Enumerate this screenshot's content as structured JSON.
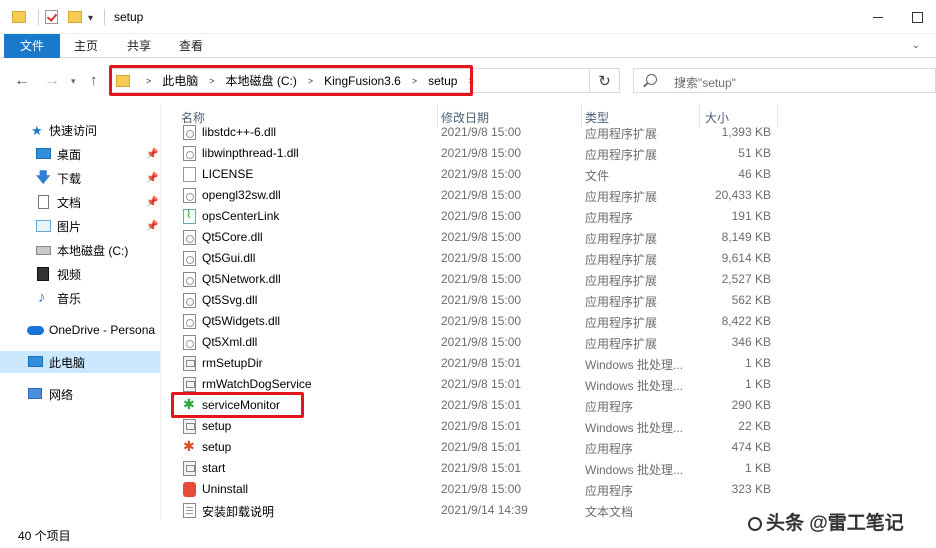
{
  "window": {
    "title": "setup"
  },
  "ribbon": {
    "tabs": [
      "文件",
      "主页",
      "共享",
      "查看"
    ]
  },
  "address": {
    "crumbs": [
      "此电脑",
      "本地磁盘 (C:)",
      "KingFusion3.6",
      "setup"
    ]
  },
  "search": {
    "placeholder": "搜索\"setup\""
  },
  "sidebar": {
    "items": [
      {
        "label": "快速访问",
        "icon": "star-icon",
        "pinned": false
      },
      {
        "label": "桌面",
        "icon": "desktop-icon",
        "pinned": true
      },
      {
        "label": "下载",
        "icon": "download-icon",
        "pinned": true
      },
      {
        "label": "文档",
        "icon": "document-icon",
        "pinned": true
      },
      {
        "label": "图片",
        "icon": "pictures-icon",
        "pinned": true
      },
      {
        "label": "本地磁盘 (C:)",
        "icon": "drive-icon",
        "pinned": false
      },
      {
        "label": "视频",
        "icon": "video-icon",
        "pinned": false
      },
      {
        "label": "音乐",
        "icon": "music-icon",
        "pinned": false
      },
      {
        "label": "OneDrive - Persona",
        "icon": "onedrive-icon",
        "pinned": false
      },
      {
        "label": "此电脑",
        "icon": "this-pc-icon",
        "pinned": false,
        "selected": true
      },
      {
        "label": "网络",
        "icon": "network-icon",
        "pinned": false
      }
    ]
  },
  "columns": {
    "name": "名称",
    "date": "修改日期",
    "type": "类型",
    "size": "大小"
  },
  "files": [
    {
      "name": "libstdc++-6.dll",
      "date": "2021/9/8 15:00",
      "type": "应用程序扩展",
      "size": "1,393 KB",
      "icon": "dll"
    },
    {
      "name": "libwinpthread-1.dll",
      "date": "2021/9/8 15:00",
      "type": "应用程序扩展",
      "size": "51 KB",
      "icon": "dll"
    },
    {
      "name": "LICENSE",
      "date": "2021/9/8 15:00",
      "type": "文件",
      "size": "46 KB",
      "icon": "file"
    },
    {
      "name": "opengl32sw.dll",
      "date": "2021/9/8 15:00",
      "type": "应用程序扩展",
      "size": "20,433 KB",
      "icon": "dll"
    },
    {
      "name": "opsCenterLink",
      "date": "2021/9/8 15:00",
      "type": "应用程序",
      "size": "191 KB",
      "icon": "chart"
    },
    {
      "name": "Qt5Core.dll",
      "date": "2021/9/8 15:00",
      "type": "应用程序扩展",
      "size": "8,149 KB",
      "icon": "dll"
    },
    {
      "name": "Qt5Gui.dll",
      "date": "2021/9/8 15:00",
      "type": "应用程序扩展",
      "size": "9,614 KB",
      "icon": "dll"
    },
    {
      "name": "Qt5Network.dll",
      "date": "2021/9/8 15:00",
      "type": "应用程序扩展",
      "size": "2,527 KB",
      "icon": "dll"
    },
    {
      "name": "Qt5Svg.dll",
      "date": "2021/9/8 15:00",
      "type": "应用程序扩展",
      "size": "562 KB",
      "icon": "dll"
    },
    {
      "name": "Qt5Widgets.dll",
      "date": "2021/9/8 15:00",
      "type": "应用程序扩展",
      "size": "8,422 KB",
      "icon": "dll"
    },
    {
      "name": "Qt5Xml.dll",
      "date": "2021/9/8 15:00",
      "type": "应用程序扩展",
      "size": "346 KB",
      "icon": "dll"
    },
    {
      "name": "rmSetupDir",
      "date": "2021/9/8 15:01",
      "type": "Windows 批处理...",
      "size": "1 KB",
      "icon": "bat"
    },
    {
      "name": "rmWatchDogService",
      "date": "2021/9/8 15:01",
      "type": "Windows 批处理...",
      "size": "1 KB",
      "icon": "bat"
    },
    {
      "name": "serviceMonitor",
      "date": "2021/9/8 15:01",
      "type": "应用程序",
      "size": "290 KB",
      "icon": "exe",
      "highlighted": true
    },
    {
      "name": "setup",
      "date": "2021/9/8 15:01",
      "type": "Windows 批处理...",
      "size": "22 KB",
      "icon": "bat"
    },
    {
      "name": "setup",
      "date": "2021/9/8 15:01",
      "type": "应用程序",
      "size": "474 KB",
      "icon": "exe"
    },
    {
      "name": "start",
      "date": "2021/9/8 15:01",
      "type": "Windows 批处理...",
      "size": "1 KB",
      "icon": "bat"
    },
    {
      "name": "Uninstall",
      "date": "2021/9/8 15:00",
      "type": "应用程序",
      "size": "323 KB",
      "icon": "uninst"
    },
    {
      "name": "安装卸载说明",
      "date": "2021/9/14 14:39",
      "type": "文本文档",
      "size": "",
      "icon": "txt"
    }
  ],
  "status": {
    "item_count": "40 个项目"
  },
  "watermark": {
    "text": "头条 @雷工笔记"
  },
  "colors": {
    "accent": "#1979ca",
    "highlight_border": "#e3161c",
    "selection": "#cce8ff"
  }
}
